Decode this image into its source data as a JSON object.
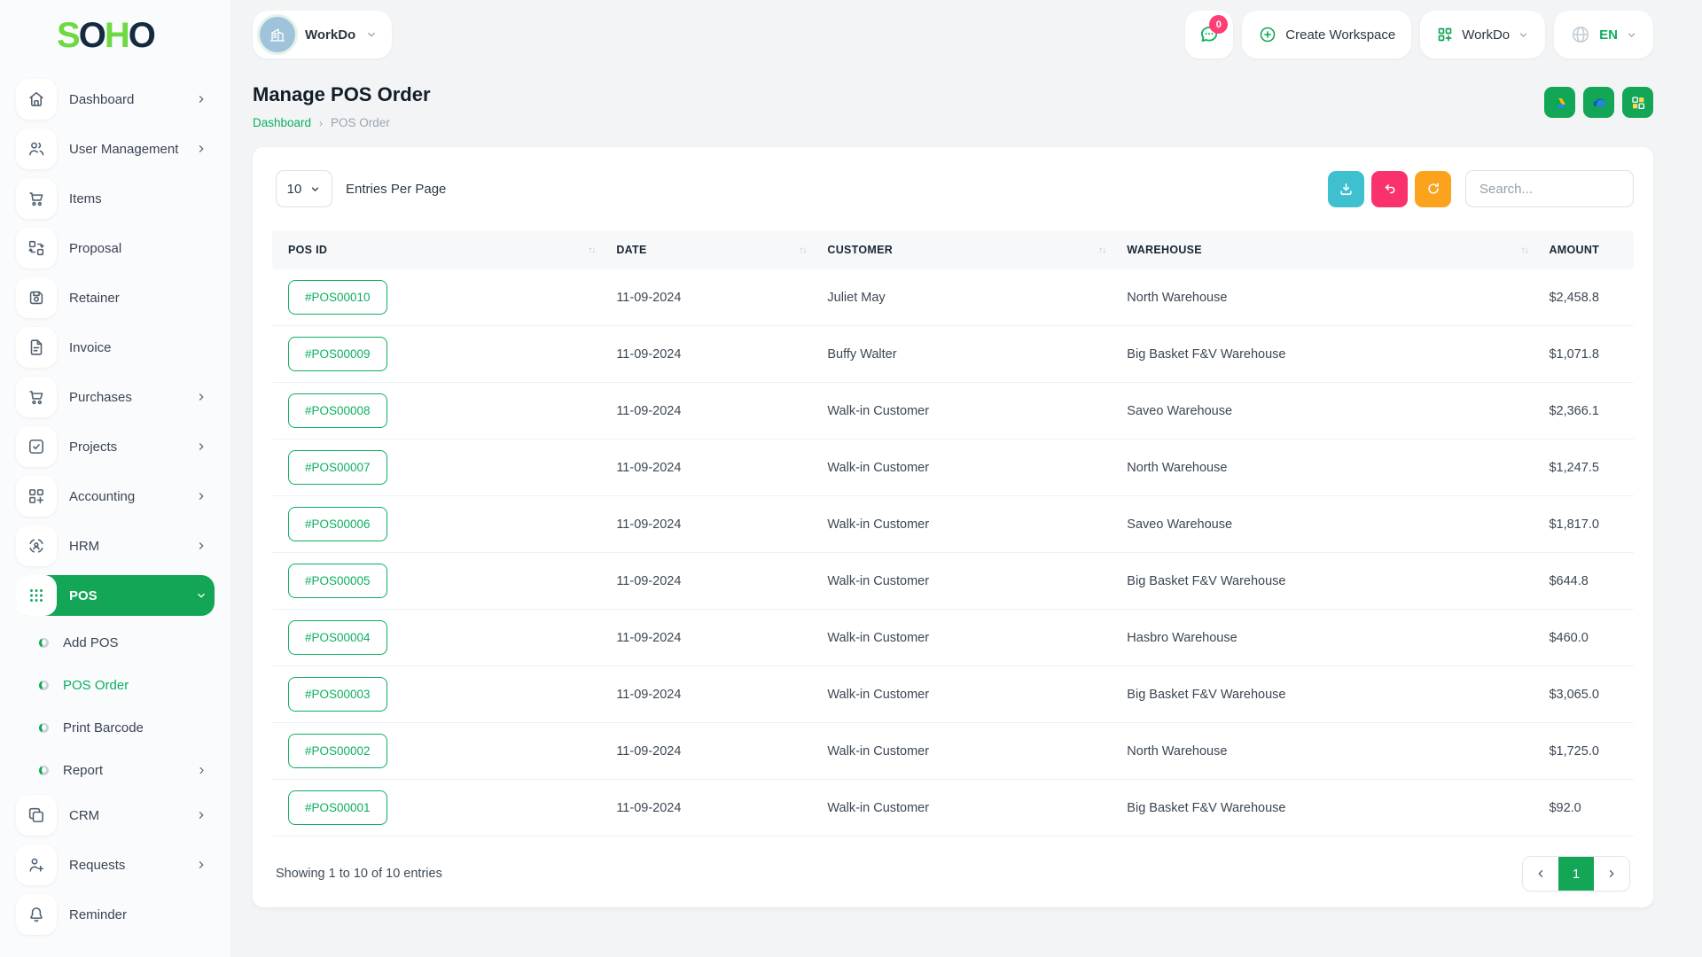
{
  "brand": {
    "letters": [
      {
        "ch": "S",
        "color": "#6fd943"
      },
      {
        "ch": "O",
        "color": "#142b3f"
      },
      {
        "ch": "H",
        "color": "#6fd943"
      },
      {
        "ch": "O",
        "color": "#142b3f"
      }
    ]
  },
  "topbar": {
    "workspace_label": "WorkDo",
    "chat_badge": "0",
    "create_workspace_label": "Create Workspace",
    "workdo_menu_label": "WorkDo",
    "language_label": "EN"
  },
  "sidebar": {
    "items": [
      {
        "label": "Dashboard",
        "icon": "home"
      },
      {
        "label": "User Management",
        "icon": "users"
      },
      {
        "label": "Items",
        "icon": "cart"
      },
      {
        "label": "Proposal",
        "icon": "transform"
      },
      {
        "label": "Retainer",
        "icon": "floppy"
      },
      {
        "label": "Invoice",
        "icon": "file-invoice"
      },
      {
        "label": "Purchases",
        "icon": "cart"
      },
      {
        "label": "Projects",
        "icon": "check-square"
      },
      {
        "label": "Accounting",
        "icon": "grid-plus"
      },
      {
        "label": "HRM",
        "icon": "scan-user"
      },
      {
        "label": "POS",
        "icon": "grid-dots"
      },
      {
        "label": "CRM",
        "icon": "copy"
      },
      {
        "label": "Requests",
        "icon": "user-plus"
      },
      {
        "label": "Reminder",
        "icon": "bell"
      }
    ],
    "pos_children": [
      {
        "label": "Add POS"
      },
      {
        "label": "POS Order"
      },
      {
        "label": "Print Barcode"
      },
      {
        "label": "Report"
      }
    ]
  },
  "page": {
    "title": "Manage POS Order",
    "breadcrumb_home": "Dashboard",
    "breadcrumb_current": "POS Order"
  },
  "toolbar": {
    "entries_value": "10",
    "entries_label": "Entries Per Page",
    "search_placeholder": "Search..."
  },
  "table": {
    "columns": [
      "POS ID",
      "DATE",
      "CUSTOMER",
      "WAREHOUSE",
      "AMOUNT"
    ],
    "rows": [
      {
        "id": "#POS00010",
        "date": "11-09-2024",
        "customer": "Juliet May",
        "warehouse": "North Warehouse",
        "amount": "$2,458.8"
      },
      {
        "id": "#POS00009",
        "date": "11-09-2024",
        "customer": "Buffy Walter",
        "warehouse": "Big Basket F&V Warehouse",
        "amount": "$1,071.8"
      },
      {
        "id": "#POS00008",
        "date": "11-09-2024",
        "customer": "Walk-in Customer",
        "warehouse": "Saveo Warehouse",
        "amount": "$2,366.1"
      },
      {
        "id": "#POS00007",
        "date": "11-09-2024",
        "customer": "Walk-in Customer",
        "warehouse": "North Warehouse",
        "amount": "$1,247.5"
      },
      {
        "id": "#POS00006",
        "date": "11-09-2024",
        "customer": "Walk-in Customer",
        "warehouse": "Saveo Warehouse",
        "amount": "$1,817.0"
      },
      {
        "id": "#POS00005",
        "date": "11-09-2024",
        "customer": "Walk-in Customer",
        "warehouse": "Big Basket F&V Warehouse",
        "amount": "$644.8"
      },
      {
        "id": "#POS00004",
        "date": "11-09-2024",
        "customer": "Walk-in Customer",
        "warehouse": "Hasbro Warehouse",
        "amount": "$460.0"
      },
      {
        "id": "#POS00003",
        "date": "11-09-2024",
        "customer": "Walk-in Customer",
        "warehouse": "Big Basket F&V Warehouse",
        "amount": "$3,065.0"
      },
      {
        "id": "#POS00002",
        "date": "11-09-2024",
        "customer": "Walk-in Customer",
        "warehouse": "North Warehouse",
        "amount": "$1,725.0"
      },
      {
        "id": "#POS00001",
        "date": "11-09-2024",
        "customer": "Walk-in Customer",
        "warehouse": "Big Basket F&V Warehouse",
        "amount": "$92.0"
      }
    ]
  },
  "footer": {
    "showing": "Showing 1 to 10 of 10 entries",
    "page": "1"
  },
  "colors": {
    "primary_text": "#0caf60",
    "primary_solid": "#12a656",
    "logo_green": "#6fd943",
    "logo_dark": "#142b3f",
    "cyan_button": "#3ec0ce",
    "pink_button": "#f9316d",
    "orange_button": "#fba31c",
    "badge_pink": "#ff3e74"
  }
}
